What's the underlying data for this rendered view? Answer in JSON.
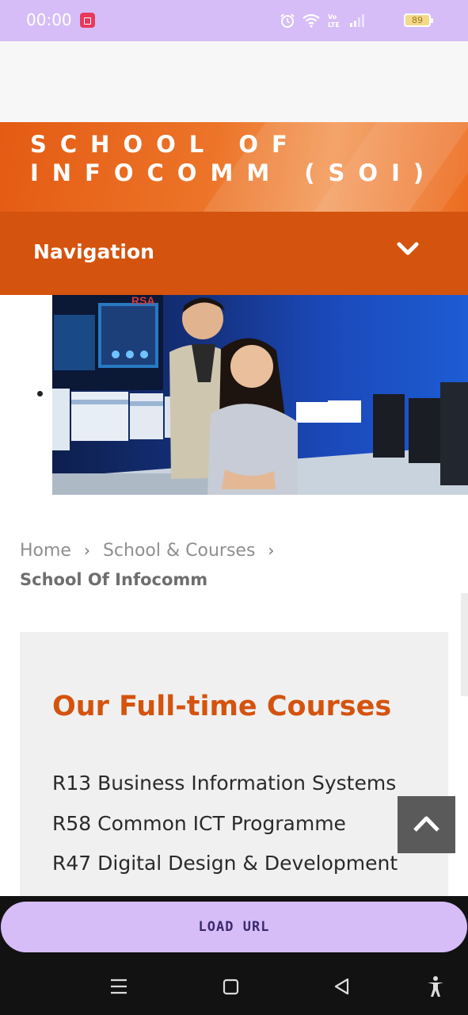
{
  "status_bar": {
    "time": "00:00",
    "battery_level": "89",
    "icons": [
      "recording-icon",
      "alarm-icon",
      "wifi-icon",
      "volte-icon",
      "signal-icon",
      "battery-icon"
    ]
  },
  "site": {
    "school_title": "SCHOOL OF INFOCOMM (SOI)",
    "nav_label": "Navigation"
  },
  "breadcrumb": {
    "items": [
      "Home",
      "School & Courses"
    ],
    "current": "School Of Infocomm"
  },
  "courses": {
    "heading": "Our Full-time Courses",
    "items": [
      "R13 Business Information Systems",
      "R58 Common ICT Programme",
      "R47 Digital Design & Development"
    ]
  },
  "browser": {
    "load_url_label": "LOAD URL"
  },
  "colors": {
    "status_bar": "#d6bdf8",
    "brand_orange": "#d4530e",
    "heading_orange": "#d4530e",
    "back_to_top": "#5a5a5a"
  }
}
